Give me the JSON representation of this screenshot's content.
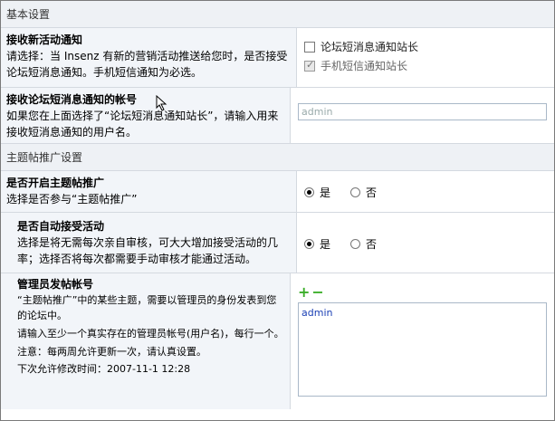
{
  "sections": {
    "basic": "基本设置",
    "promo": "主题帖推广设置"
  },
  "notify": {
    "title": "接收新活动通知",
    "desc": "请选择：当 Insenz 有新的营销活动推送给您时，是否接受论坛短消息通知。手机短信通知为必选。",
    "options": [
      {
        "label": "论坛短消息通知站长",
        "checked": false
      },
      {
        "label": "手机短信通知站长",
        "checked": true
      }
    ]
  },
  "account": {
    "title": "接收论坛短消息通知的帐号",
    "desc": "如果您在上面选择了“论坛短消息通知站长”，请输入用来接收短消息通知的用户名。",
    "value": "admin"
  },
  "enable_promo": {
    "title": "是否开启主题帖推广",
    "desc": "选择是否参与“主题帖推广”",
    "yes": "是",
    "no": "否",
    "selected": "yes"
  },
  "auto_accept": {
    "title": "是否自动接受活动",
    "desc": "选择是将无需每次亲自审核，可大大增加接受活动的几率；选择否将每次都需要手动审核才能通过活动。",
    "yes": "是",
    "no": "否",
    "selected": "yes"
  },
  "admin_account": {
    "title": "管理员发帖帐号",
    "desc1": "“主题帖推广”中的某些主题，需要以管理员的身份发表到您的论坛中。",
    "desc2": "请输入至少一个真实存在的管理员帐号(用户名)，每行一个。",
    "note": "注意：每两周允许更新一次，请认真设置。",
    "next_time": "下次允许修改时间：2007-11-1 12:28",
    "plus": "+",
    "minus": "−",
    "value": "admin"
  },
  "icons": {
    "cursor": "mouse-pointer-icon"
  }
}
